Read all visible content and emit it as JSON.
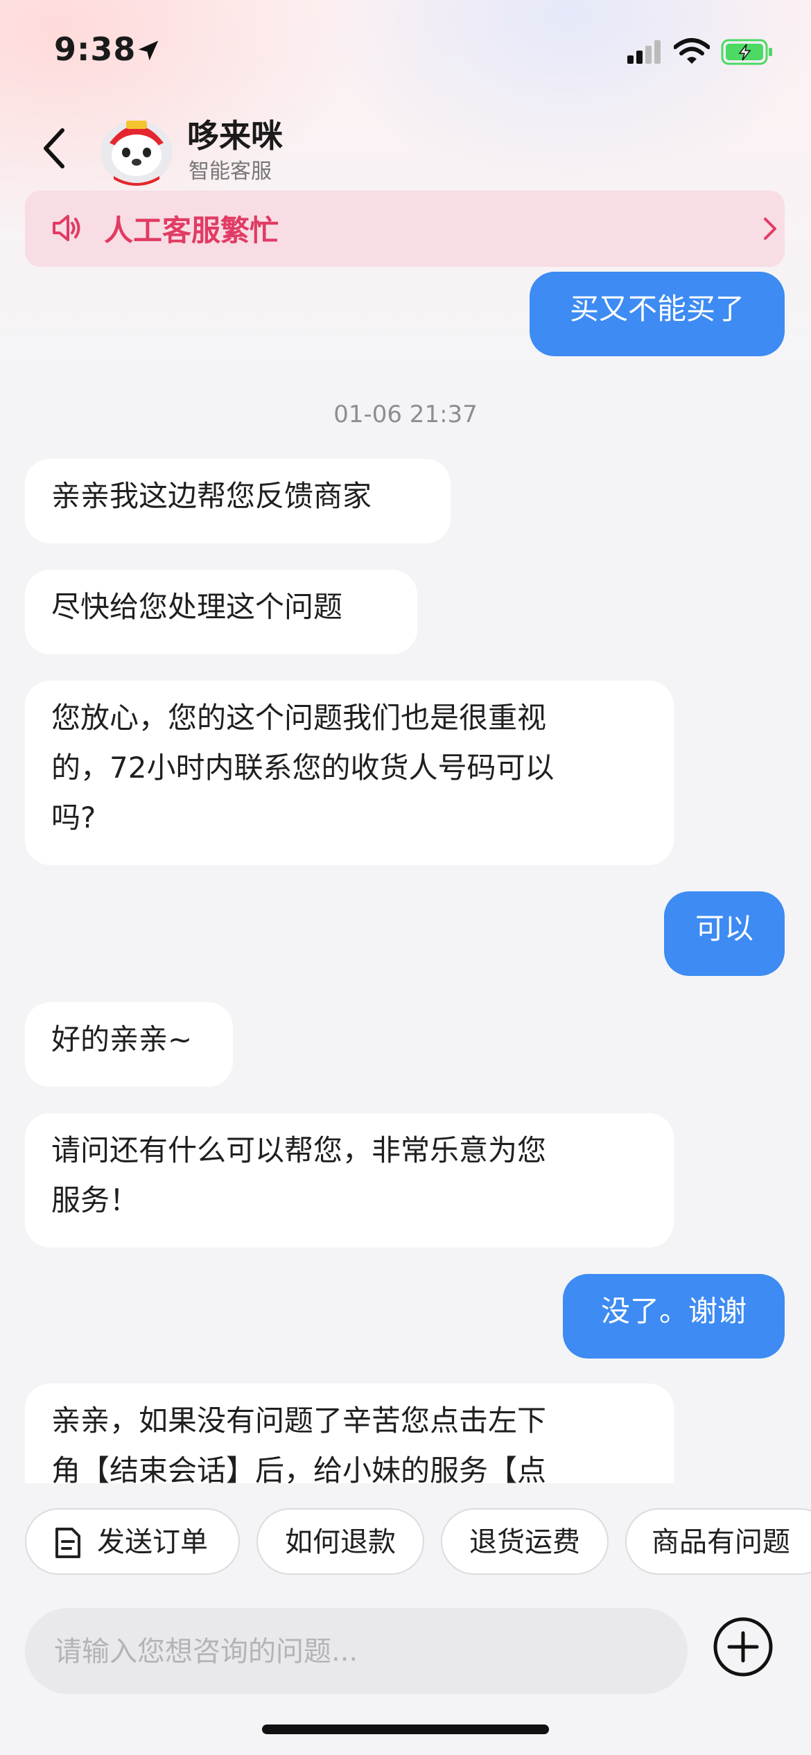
{
  "status_bar": {
    "time": "9:38"
  },
  "header": {
    "title": "哆来咪",
    "subtitle": "智能客服"
  },
  "notice": {
    "text": "人工客服繁忙"
  },
  "messages": [
    {
      "side": "out",
      "text": "买又不能买了"
    },
    {
      "side": "in",
      "text": "亲亲我这边帮您反馈商家"
    },
    {
      "side": "in",
      "text": "尽快给您处理这个问题"
    },
    {
      "side": "in",
      "line1": "您放心，您的这个问题我们也是很重视",
      "line2": "的，72小时内联系您的收货人号码可以",
      "line3": "吗?"
    },
    {
      "side": "out",
      "text": "可以"
    },
    {
      "side": "in",
      "text": "好的亲亲~"
    },
    {
      "side": "in",
      "line1": "请问还有什么可以帮您，非常乐意为您",
      "line2": "服务！"
    },
    {
      "side": "out",
      "text": "没了。谢谢"
    },
    {
      "side": "in",
      "line1": "亲亲，如果没有问题了辛苦您点击左下",
      "line2": "角【结束会话】后，给小妹的服务【点"
    }
  ],
  "timestamp": "01-06 21:37",
  "quick_replies": [
    "发送订单",
    "如何退款",
    "退货运费",
    "商品有问题"
  ],
  "input": {
    "placeholder": "请输入您想咨询的问题..."
  },
  "colors": {
    "outgoing_bubble": "#3d8bf3",
    "notice_text": "#e13b64",
    "notice_bg": "#f8dde4",
    "battery_green": "#4cd964"
  }
}
